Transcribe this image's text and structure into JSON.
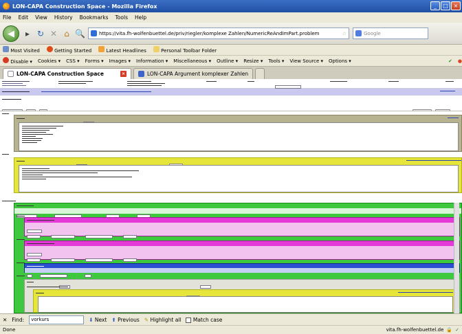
{
  "window": {
    "title": "LON-CAPA Construction Space - Mozilla Firefox"
  },
  "menu": [
    "File",
    "Edit",
    "View",
    "History",
    "Bookmarks",
    "Tools",
    "Help"
  ],
  "nav": {
    "url": "https://vita.fh-wolfenbuettel.de/priv/riegler/komplexe Zahlen/NumericReAndImPart.problem",
    "search_placeholder": "Google"
  },
  "bookmarks": [
    "Most Visited",
    "Getting Started",
    "Latest Headlines",
    "Personal Toolbar Folder"
  ],
  "devtoolbar": [
    "Disable",
    "Cookies",
    "CSS",
    "Forms",
    "Images",
    "Information",
    "Miscellaneous",
    "Outline",
    "Resize",
    "Tools",
    "View Source",
    "Options"
  ],
  "tabs": [
    {
      "label": "LON-CAPA Construction Space",
      "active": true
    },
    {
      "label": "LON-CAPA Argument komplexer Zahlen",
      "active": false
    }
  ],
  "find": {
    "label": "Find:",
    "value": "vorkurs",
    "next": "Next",
    "previous": "Previous",
    "highlight": "Highlight all",
    "matchcase": "Match case"
  },
  "status": {
    "left": "Done",
    "right": "vita.fh-wolfenbuettel.de"
  },
  "colors": {
    "yellow": "#e6e63a",
    "green": "#3ec83e",
    "magenta": "#e43ad8",
    "blue": "#2a4fd0",
    "olive": "#b7b391",
    "lavender": "#c9c9f0"
  }
}
